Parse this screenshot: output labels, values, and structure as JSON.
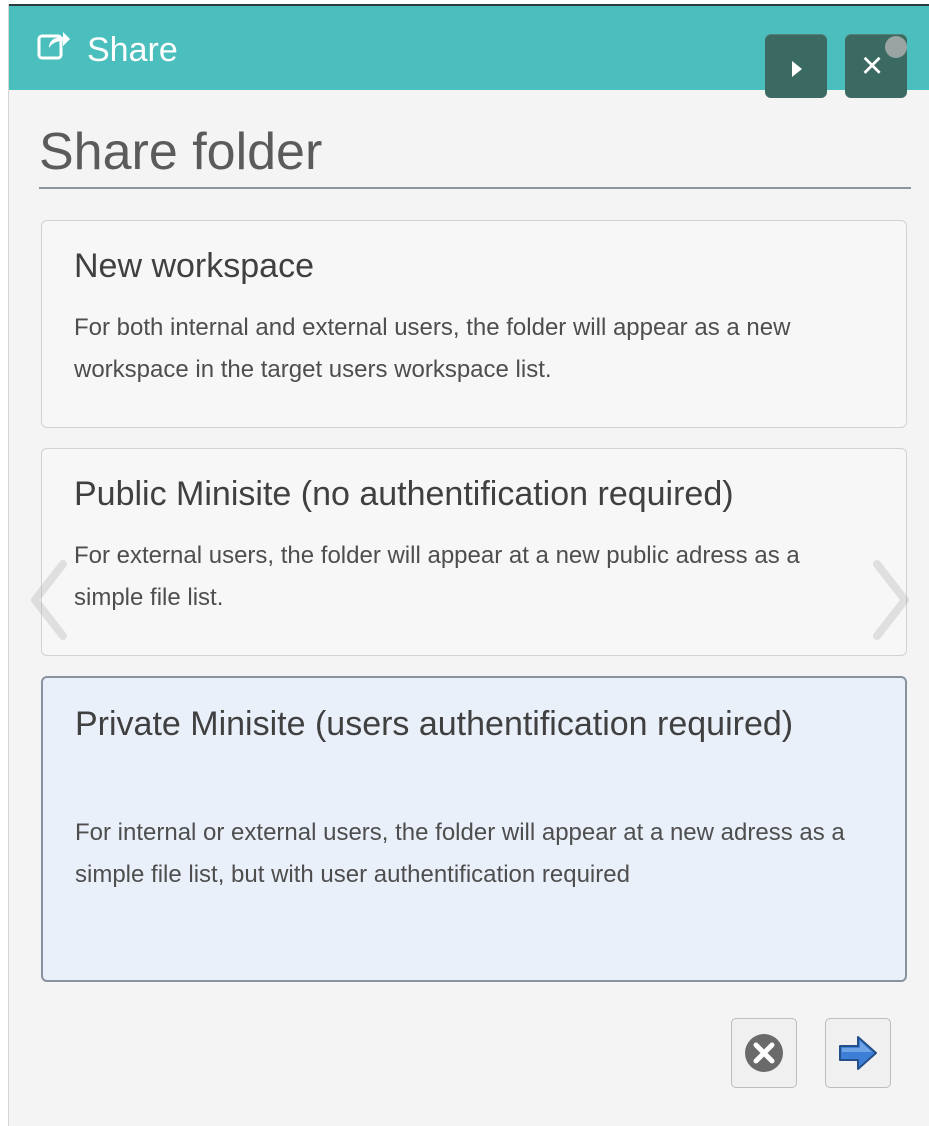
{
  "dialog": {
    "title": "Share",
    "heading": "Share folder"
  },
  "options": [
    {
      "title": "New workspace",
      "description": "For both internal and external users, the folder will appear as a new workspace in the target users workspace list.",
      "selected": false
    },
    {
      "title": "Public Minisite (no authentification required)",
      "description": "For external users, the folder will appear at a new public adress as a simple file list.",
      "selected": false
    },
    {
      "title": "Private Minisite (users authentification required)",
      "description": "For internal or external users, the folder will appear at a new adress as a simple file list, but with user authentification required",
      "selected": true
    }
  ],
  "icons": {
    "title": "share-icon",
    "play": "play-icon",
    "close": "close-icon",
    "carousel_prev": "chevron-left-icon",
    "carousel_next": "chevron-right-icon",
    "cancel": "cancel-circle-icon",
    "next": "arrow-right-icon"
  },
  "colors": {
    "titlebar": "#4bbfbe",
    "titlebar_buttons": "#3b6a62",
    "selected_card": "#eaf0fa",
    "next_arrow": "#3d7fd6"
  }
}
